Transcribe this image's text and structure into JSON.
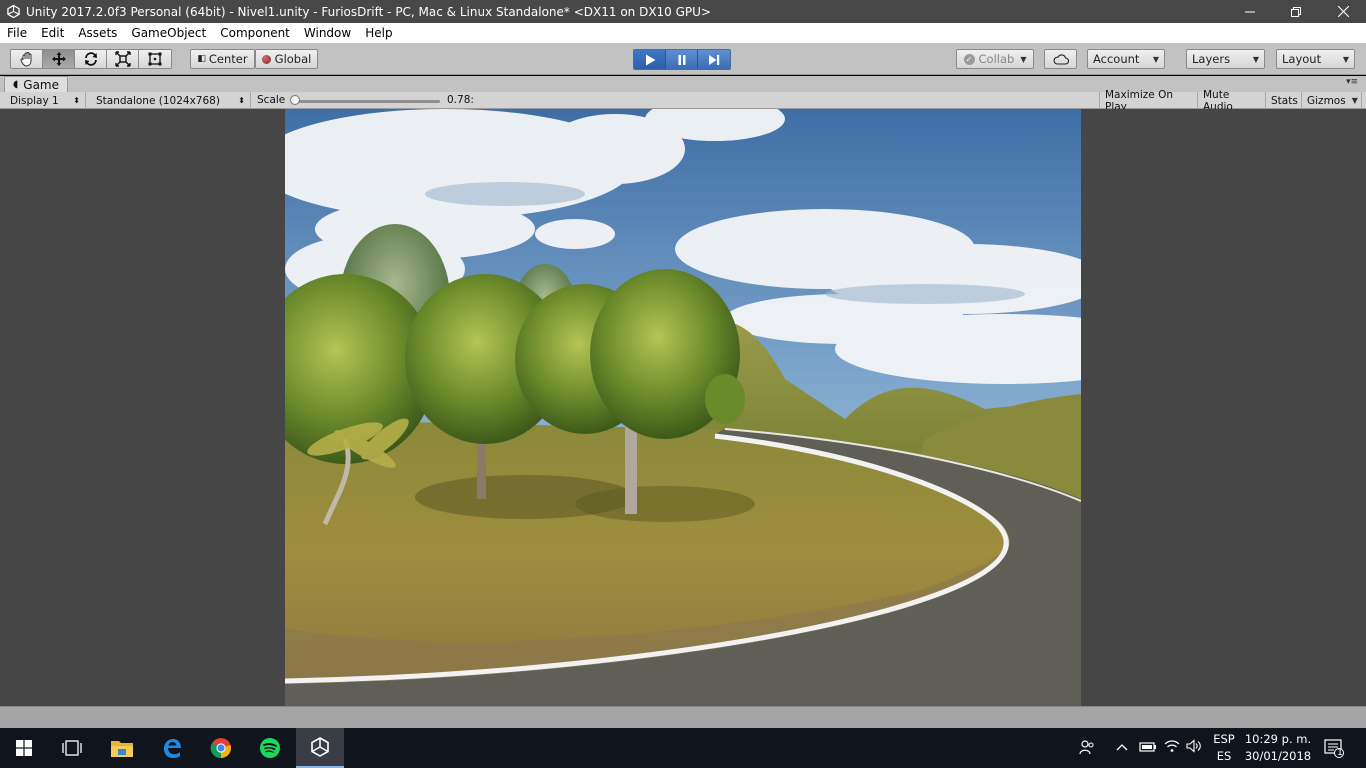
{
  "window": {
    "title": "Unity 2017.2.0f3 Personal (64bit) - Nivel1.unity - FuriosDrift - PC, Mac & Linux Standalone* <DX11 on DX10 GPU>",
    "controls": [
      "minimize",
      "restore",
      "close"
    ]
  },
  "menu": {
    "items": [
      "File",
      "Edit",
      "Assets",
      "GameObject",
      "Component",
      "Window",
      "Help"
    ]
  },
  "toolbar": {
    "tools": [
      "hand-tool",
      "move-tool",
      "rotate-tool",
      "scale-tool",
      "rect-tool"
    ],
    "pivot_label": "Center",
    "space_label": "Global",
    "collab_label": "Collab",
    "account_label": "Account",
    "layers_label": "Layers",
    "layout_label": "Layout"
  },
  "game_view": {
    "tab_label": "Game",
    "display": "Display 1",
    "resolution": "Standalone (1024x768)",
    "scale_label": "Scale",
    "scale_value": "0.78:",
    "scale_fraction": 0.0,
    "maximize_on_play": "Maximize On Play",
    "mute_audio": "Mute Audio",
    "stats": "Stats",
    "gizmos": "Gizmos"
  },
  "taskbar": {
    "apps": [
      "windows-start",
      "task-view",
      "file-explorer",
      "edge",
      "chrome",
      "spotify",
      "unity"
    ],
    "language_top": "ESP",
    "language_bottom": "ES",
    "time": "10:29 p. m.",
    "date": "30/01/2018",
    "notification_count": "1"
  },
  "colors": {
    "play_blue": "#3f78c8",
    "toolbar_gray": "#c2c2c2",
    "game_bg": "#464646",
    "taskbar": "#10141c"
  }
}
